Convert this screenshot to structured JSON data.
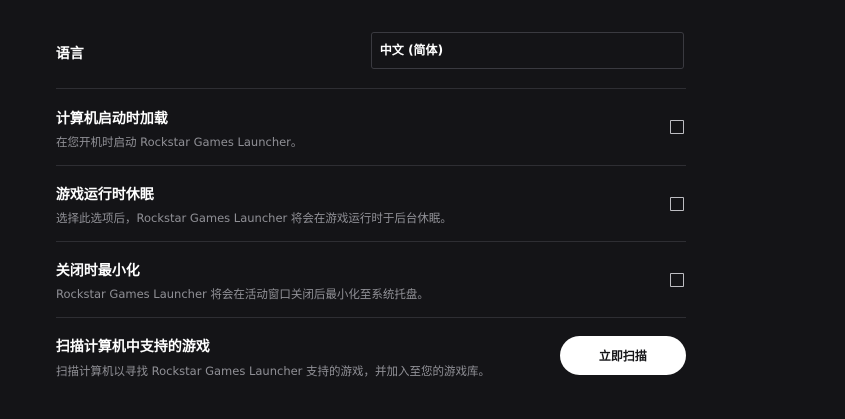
{
  "language": {
    "label": "语言",
    "selected": "中文 (简体)"
  },
  "settings": [
    {
      "label": "计算机启动时加载",
      "description": "在您开机时启动 Rockstar Games Launcher。",
      "checked": false
    },
    {
      "label": "游戏运行时休眠",
      "description": "选择此选项后，Rockstar Games Launcher 将会在游戏运行时于后台休眠。",
      "checked": false
    },
    {
      "label": "关闭时最小化",
      "description": "Rockstar Games Launcher 将会在活动窗口关闭后最小化至系统托盘。",
      "checked": false
    }
  ],
  "scan": {
    "label": "扫描计算机中支持的游戏",
    "description": "扫描计算机以寻找 Rockstar Games Launcher 支持的游戏，并加入至您的游戏库。",
    "button_label": "立即扫描"
  },
  "colors": {
    "background": "#141417",
    "divider": "#2e2e33",
    "description_text": "#8f8f95",
    "button_bg": "#ffffff"
  }
}
